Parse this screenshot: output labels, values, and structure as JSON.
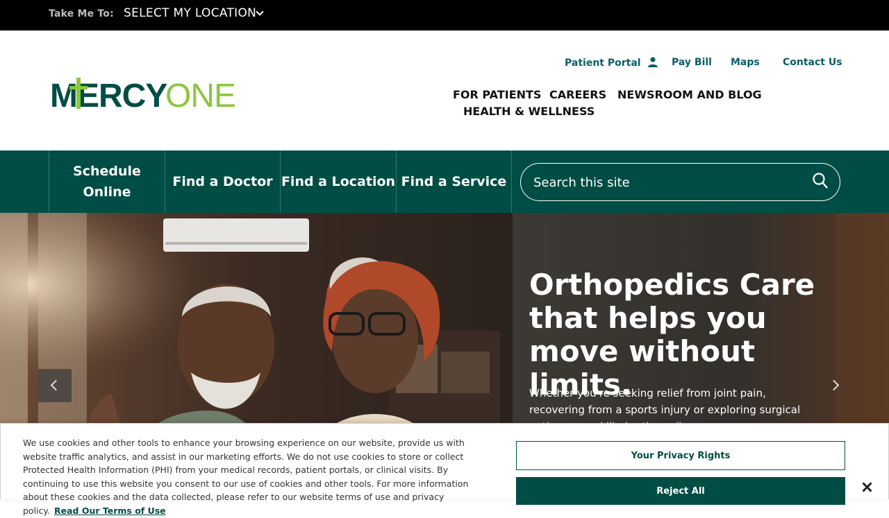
{
  "topbar": {
    "take_me_to": "Take Me To:",
    "location_select": "SELECT MY LOCATION"
  },
  "header": {
    "logo_text_left": "MERCY",
    "logo_text_right": "ONE",
    "utility_nav": [
      {
        "label": "Patient Portal",
        "icon": "user-icon"
      },
      {
        "label": "Pay Bill"
      },
      {
        "label": "Maps"
      },
      {
        "label": "Contact Us"
      }
    ],
    "main_nav": [
      {
        "label": "FOR PATIENTS"
      },
      {
        "label": "CAREERS"
      },
      {
        "label": "NEWSROOM AND BLOG"
      },
      {
        "label": "HEALTH & WELLNESS"
      }
    ]
  },
  "actions": [
    {
      "label": "Schedule Online"
    },
    {
      "label": "Find a Doctor"
    },
    {
      "label": "Find a Location"
    },
    {
      "label": "Find a Service"
    }
  ],
  "search": {
    "placeholder": "Search this site",
    "icon": "search-icon"
  },
  "hero": {
    "title": "Orthopedics Care that helps you move without limits.",
    "body": "Whether you're seeking relief from joint pain, recovering from a sports injury or exploring surgical options, our skilled orthopedic..."
  },
  "cookie": {
    "text": "We use cookies and other tools to enhance your browsing experience on our website, provide us with website traffic analytics, and assist in our marketing efforts. We do not use cookies to store or collect Protected Health Information (PHI) from your medical records, patient portals, or clinical visits. By continuing to use this website you consent to our use of cookies and other tools. For more information about these cookies and the data collected, please refer to our website terms of use and privacy policy.",
    "link": "Read Our Terms of Use",
    "privacy_button": "Your Privacy Rights",
    "reject_button": "Reject All"
  },
  "colors": {
    "brand_dark_green": "#004d45",
    "brand_lime": "#8cc63f",
    "link_teal": "#0a5e66"
  }
}
